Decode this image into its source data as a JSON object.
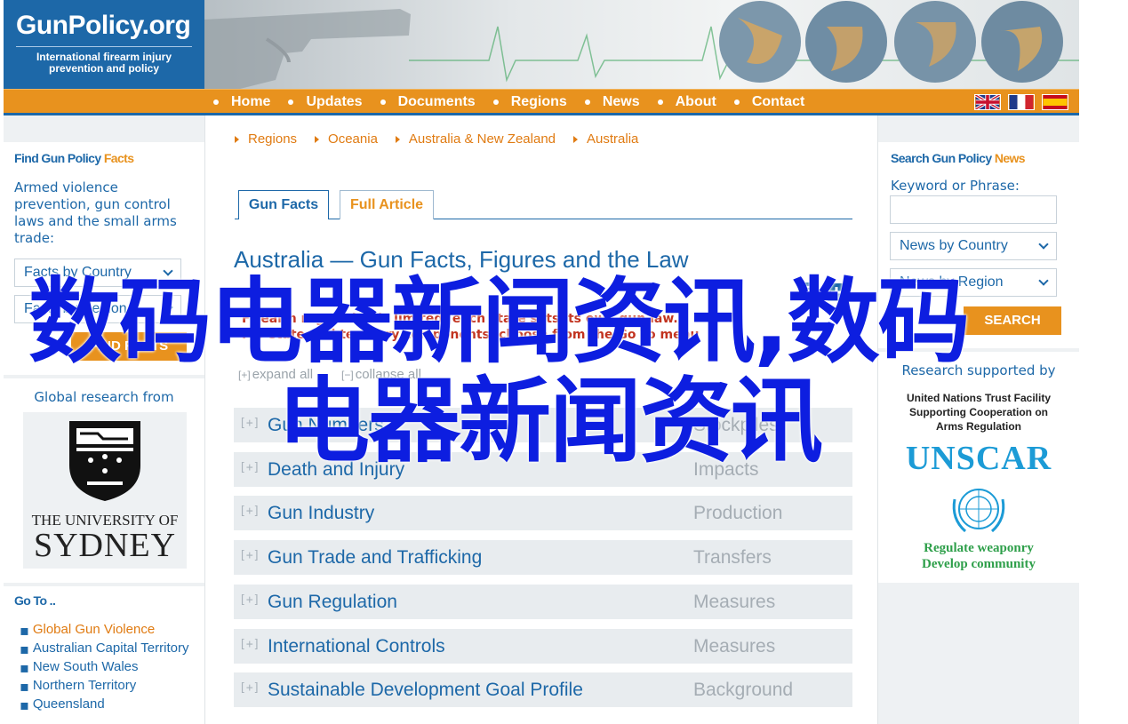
{
  "header": {
    "logo_name": "GunPolicy.org",
    "logo_tagline_1": "International firearm injury",
    "logo_tagline_2": "prevention and policy"
  },
  "nav": {
    "items": [
      "Home",
      "Updates",
      "Documents",
      "Regions",
      "News",
      "About",
      "Contact"
    ]
  },
  "left": {
    "find_title_a": "Find Gun Policy ",
    "find_title_b": "Facts",
    "find_desc": "Armed violence prevention, gun control laws and the small arms trade:",
    "select1": "Facts by Country",
    "select2": "Facts by Region",
    "find_button": "FIND FACTS",
    "research_label": "Global research from",
    "uni_line1": "THE UNIVERSITY OF",
    "uni_line2": "SYDNEY",
    "goto_title": "Go To ..",
    "goto_items": [
      "Global Gun Violence",
      "Australian Capital Territory",
      "New South Wales",
      "Northern Territory",
      "Queensland"
    ]
  },
  "breadcrumb": [
    "Regions",
    "Oceania",
    "Australia & New Zealand",
    "Australia"
  ],
  "tabs": {
    "gun_facts": "Gun Facts",
    "full_article": "Full Article"
  },
  "main": {
    "title": "Australia — Gun Facts, Figures and the Law",
    "notice_1": "Firearm regulation is limited: each state sets its own gun law.",
    "notice_2": "For state and territory components, choose from the Go To menu",
    "expand_all": "expand all",
    "collapse_all": "collapse all",
    "rows": [
      {
        "label": "Gun Numbers",
        "cat": "Stockpiles"
      },
      {
        "label": "Death and Injury",
        "cat": "Impacts"
      },
      {
        "label": "Gun Industry",
        "cat": "Production"
      },
      {
        "label": "Gun Trade and Trafficking",
        "cat": "Transfers"
      },
      {
        "label": "Gun Regulation",
        "cat": "Measures"
      },
      {
        "label": "International Controls",
        "cat": "Measures"
      },
      {
        "label": "Sustainable Development Goal Profile",
        "cat": "Background"
      }
    ]
  },
  "right": {
    "search_title_a": "Search Gun Policy ",
    "search_title_b": "News",
    "keyword_label": "Keyword or Phrase:",
    "select1": "News by Country",
    "select2": "News by Region",
    "search_button": "SEARCH",
    "research_label": "Research supported by",
    "un_line1": "United Nations Trust Facility",
    "un_line2": "Supporting Cooperation on",
    "un_line3": "Arms Regulation",
    "unscar": "UNSCAR",
    "unscar_tag1": "Regulate weaponry",
    "unscar_tag2": "Develop community"
  },
  "watermark": {
    "line1": "数码电器新闻资讯,数码",
    "line2": "电器新闻资讯"
  },
  "colors": {
    "brand_blue": "#1d68a8",
    "accent_orange": "#e8921e",
    "watermark_blue": "#0d1ee0"
  }
}
